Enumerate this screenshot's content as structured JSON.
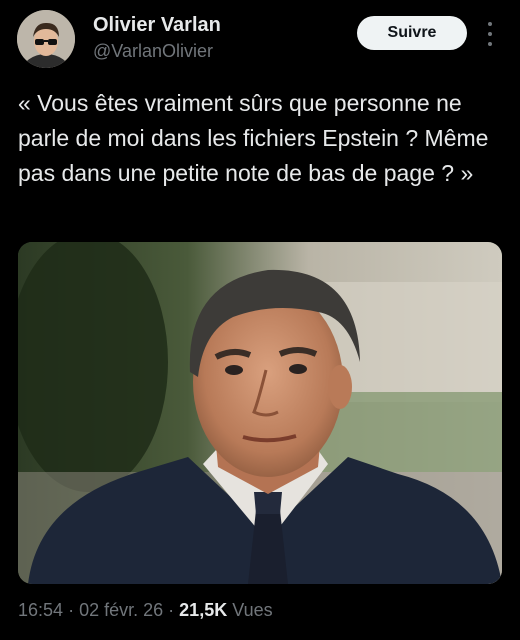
{
  "author": {
    "name": "Olivier Varlan",
    "handle": "@VarlanOlivier"
  },
  "follow_label": "Suivre",
  "tweet": {
    "text": "« Vous êtes vraiment sûrs que personne ne parle de moi dans les fichiers Epstein ? Même pas dans une petite note de bas de page ? »"
  },
  "meta": {
    "time": "16:54",
    "separator": "·",
    "date": "02 févr. 26",
    "views_count": "21,5K",
    "views_label": "Vues"
  },
  "colors": {
    "background": "#000000",
    "text": "#e7e9ea",
    "secondary_text": "#71767b",
    "follow_button_bg": "#eff3f4"
  },
  "icons": {
    "more": "more-dots-vertical-icon"
  }
}
